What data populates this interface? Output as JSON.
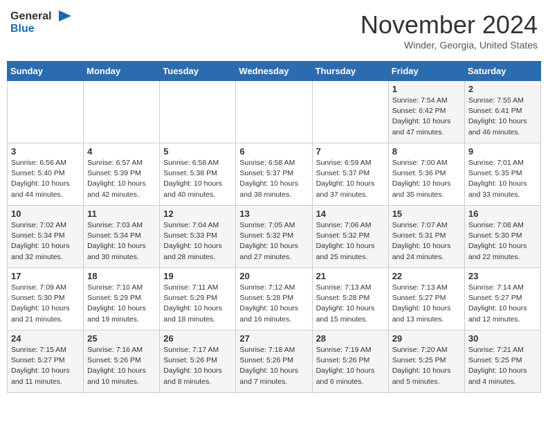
{
  "header": {
    "logo_general": "General",
    "logo_blue": "Blue",
    "month": "November 2024",
    "location": "Winder, Georgia, United States"
  },
  "weekdays": [
    "Sunday",
    "Monday",
    "Tuesday",
    "Wednesday",
    "Thursday",
    "Friday",
    "Saturday"
  ],
  "weeks": [
    [
      {
        "day": "",
        "info": ""
      },
      {
        "day": "",
        "info": ""
      },
      {
        "day": "",
        "info": ""
      },
      {
        "day": "",
        "info": ""
      },
      {
        "day": "",
        "info": ""
      },
      {
        "day": "1",
        "info": "Sunrise: 7:54 AM\nSunset: 6:42 PM\nDaylight: 10 hours and 47 minutes."
      },
      {
        "day": "2",
        "info": "Sunrise: 7:55 AM\nSunset: 6:41 PM\nDaylight: 10 hours and 46 minutes."
      }
    ],
    [
      {
        "day": "3",
        "info": "Sunrise: 6:56 AM\nSunset: 5:40 PM\nDaylight: 10 hours and 44 minutes."
      },
      {
        "day": "4",
        "info": "Sunrise: 6:57 AM\nSunset: 5:39 PM\nDaylight: 10 hours and 42 minutes."
      },
      {
        "day": "5",
        "info": "Sunrise: 6:58 AM\nSunset: 5:38 PM\nDaylight: 10 hours and 40 minutes."
      },
      {
        "day": "6",
        "info": "Sunrise: 6:58 AM\nSunset: 5:37 PM\nDaylight: 10 hours and 38 minutes."
      },
      {
        "day": "7",
        "info": "Sunrise: 6:59 AM\nSunset: 5:37 PM\nDaylight: 10 hours and 37 minutes."
      },
      {
        "day": "8",
        "info": "Sunrise: 7:00 AM\nSunset: 5:36 PM\nDaylight: 10 hours and 35 minutes."
      },
      {
        "day": "9",
        "info": "Sunrise: 7:01 AM\nSunset: 5:35 PM\nDaylight: 10 hours and 33 minutes."
      }
    ],
    [
      {
        "day": "10",
        "info": "Sunrise: 7:02 AM\nSunset: 5:34 PM\nDaylight: 10 hours and 32 minutes."
      },
      {
        "day": "11",
        "info": "Sunrise: 7:03 AM\nSunset: 5:34 PM\nDaylight: 10 hours and 30 minutes."
      },
      {
        "day": "12",
        "info": "Sunrise: 7:04 AM\nSunset: 5:33 PM\nDaylight: 10 hours and 28 minutes."
      },
      {
        "day": "13",
        "info": "Sunrise: 7:05 AM\nSunset: 5:32 PM\nDaylight: 10 hours and 27 minutes."
      },
      {
        "day": "14",
        "info": "Sunrise: 7:06 AM\nSunset: 5:32 PM\nDaylight: 10 hours and 25 minutes."
      },
      {
        "day": "15",
        "info": "Sunrise: 7:07 AM\nSunset: 5:31 PM\nDaylight: 10 hours and 24 minutes."
      },
      {
        "day": "16",
        "info": "Sunrise: 7:08 AM\nSunset: 5:30 PM\nDaylight: 10 hours and 22 minutes."
      }
    ],
    [
      {
        "day": "17",
        "info": "Sunrise: 7:09 AM\nSunset: 5:30 PM\nDaylight: 10 hours and 21 minutes."
      },
      {
        "day": "18",
        "info": "Sunrise: 7:10 AM\nSunset: 5:29 PM\nDaylight: 10 hours and 19 minutes."
      },
      {
        "day": "19",
        "info": "Sunrise: 7:11 AM\nSunset: 5:29 PM\nDaylight: 10 hours and 18 minutes."
      },
      {
        "day": "20",
        "info": "Sunrise: 7:12 AM\nSunset: 5:28 PM\nDaylight: 10 hours and 16 minutes."
      },
      {
        "day": "21",
        "info": "Sunrise: 7:13 AM\nSunset: 5:28 PM\nDaylight: 10 hours and 15 minutes."
      },
      {
        "day": "22",
        "info": "Sunrise: 7:13 AM\nSunset: 5:27 PM\nDaylight: 10 hours and 13 minutes."
      },
      {
        "day": "23",
        "info": "Sunrise: 7:14 AM\nSunset: 5:27 PM\nDaylight: 10 hours and 12 minutes."
      }
    ],
    [
      {
        "day": "24",
        "info": "Sunrise: 7:15 AM\nSunset: 5:27 PM\nDaylight: 10 hours and 11 minutes."
      },
      {
        "day": "25",
        "info": "Sunrise: 7:16 AM\nSunset: 5:26 PM\nDaylight: 10 hours and 10 minutes."
      },
      {
        "day": "26",
        "info": "Sunrise: 7:17 AM\nSunset: 5:26 PM\nDaylight: 10 hours and 8 minutes."
      },
      {
        "day": "27",
        "info": "Sunrise: 7:18 AM\nSunset: 5:26 PM\nDaylight: 10 hours and 7 minutes."
      },
      {
        "day": "28",
        "info": "Sunrise: 7:19 AM\nSunset: 5:26 PM\nDaylight: 10 hours and 6 minutes."
      },
      {
        "day": "29",
        "info": "Sunrise: 7:20 AM\nSunset: 5:25 PM\nDaylight: 10 hours and 5 minutes."
      },
      {
        "day": "30",
        "info": "Sunrise: 7:21 AM\nSunset: 5:25 PM\nDaylight: 10 hours and 4 minutes."
      }
    ]
  ]
}
